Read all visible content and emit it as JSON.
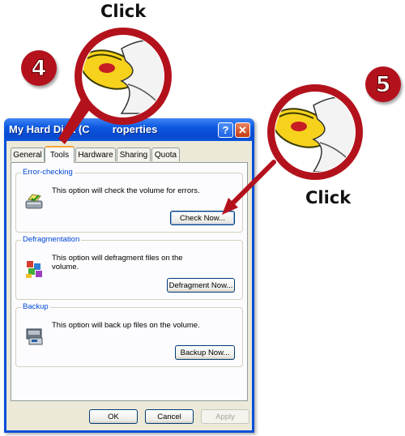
{
  "callouts": {
    "click_top": "Click",
    "click_right": "Click",
    "step4": "4",
    "step5": "5"
  },
  "dialog": {
    "title": "My Hard Disk (C:) Properties",
    "title_visible": "My Hard Disk (C",
    "title_tail": "roperties",
    "help_glyph": "?",
    "close_glyph": "✕",
    "tabs": [
      "General",
      "Tools",
      "Hardware",
      "Sharing",
      "Quota"
    ],
    "active_tab": "Tools",
    "groups": {
      "error": {
        "title": "Error-checking",
        "desc": "This option will check the volume for errors.",
        "button": "Check Now..."
      },
      "defrag": {
        "title": "Defragmentation",
        "desc": "This option will defragment files on the volume.",
        "button": "Defragment Now..."
      },
      "backup": {
        "title": "Backup",
        "desc": "This option will back up files on the volume.",
        "button": "Backup Now..."
      }
    },
    "footer": {
      "ok": "OK",
      "cancel": "Cancel",
      "apply": "Apply"
    }
  },
  "colors": {
    "callout_red": "#b3121c",
    "titlebar_blue": "#0a4fd8",
    "mouse_yellow": "#f7d21c"
  }
}
